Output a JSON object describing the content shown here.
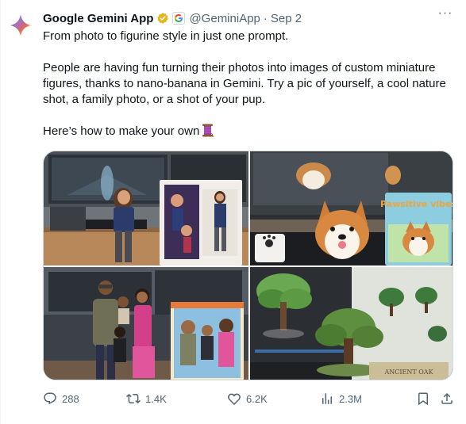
{
  "post": {
    "author_name": "Google Gemini App",
    "handle": "@GeminiApp",
    "separator": "·",
    "date": "Sep 2",
    "more_label": "···",
    "text_line1": "From photo to figurine style in just one prompt.",
    "text_para2": "People are having fun turning their photos into images of custom miniature figures, thanks to nano-banana in Gemini. Try a pic of yourself, a cool nature shot, a family photo, or a shot of your pup.",
    "text_para3": "Here’s how to make your own"
  },
  "icons": {
    "avatar": "gemini-sparkle-icon",
    "verified": "verified-gold-badge-icon",
    "affiliate": "google-g-icon",
    "emoji": "thread-spool-emoji-icon",
    "reply": "reply-icon",
    "repost": "repost-icon",
    "like": "heart-icon",
    "views": "views-chart-icon",
    "bookmark": "bookmark-icon",
    "share": "share-icon"
  },
  "images": {
    "box_text_dog": "Pawsitive vibes",
    "box_text_tree": "ANCIENT OAK"
  },
  "actions": {
    "replies": "288",
    "reposts": "1.4K",
    "likes": "6.2K",
    "views": "2.3M"
  },
  "colors": {
    "text_primary": "#0f1419",
    "text_secondary": "#536471",
    "verified_gold": "#e2b719",
    "border": "#cfd9de"
  }
}
